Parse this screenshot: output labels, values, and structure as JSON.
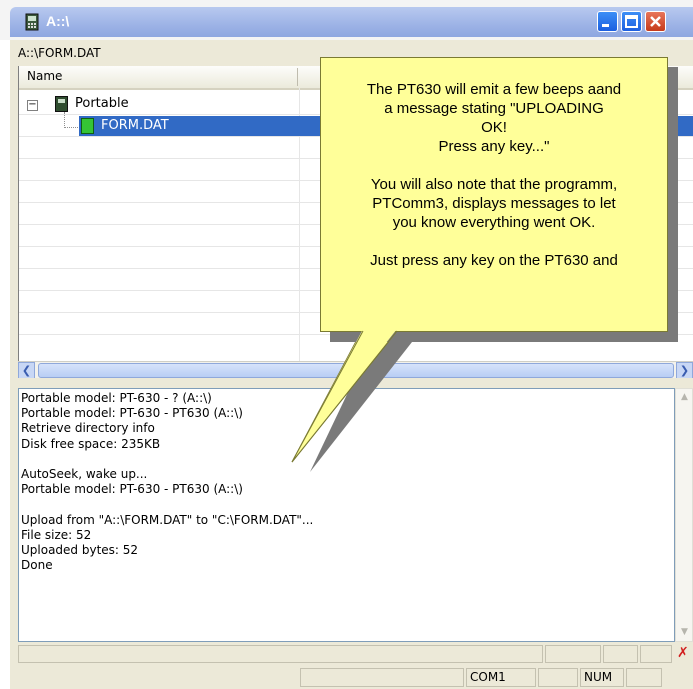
{
  "window": {
    "title": "A::\\",
    "minimize_icon": "minimize-icon",
    "maximize_icon": "maximize-icon",
    "close_icon": "close-icon"
  },
  "path_bar": "A::\\FORM.DAT",
  "tree": {
    "column_header": "Name",
    "nodes": [
      {
        "label": "Portable",
        "icon": "handheld-device-icon",
        "expanded": true
      },
      {
        "label": "FORM.DAT",
        "icon": "file-icon",
        "selected": true
      }
    ]
  },
  "log_lines": [
    "Portable model: PT-630 - ? (A::\\)",
    "Portable model: PT-630 - PT630 (A::\\)",
    "Retrieve directory info",
    "Disk free space: 235KB",
    "",
    "AutoSeek, wake up...",
    "Portable model: PT-630 - PT630 (A::\\)",
    "",
    "Upload from \"A::\\FORM.DAT\" to \"C:\\FORM.DAT\"...",
    "File size: 52",
    "Uploaded bytes: 52",
    "Done"
  ],
  "status": {
    "port": "COM1",
    "num": "NUM",
    "error_icon": "red-x-icon"
  },
  "callout": {
    "paragraph1": "The PT630 will emit a few beeps aand\na message stating \"UPLOADING\nOK!\nPress any key...\"",
    "paragraph2": "You will also note that the programm,\nPTComm3, displays messages to let\nyou know everything went OK.",
    "paragraph3": "Just press any key on the PT630 and",
    "background_color": "#ffff99"
  },
  "colors": {
    "selection": "#316ac5",
    "titlebar": "#9db3e6"
  }
}
